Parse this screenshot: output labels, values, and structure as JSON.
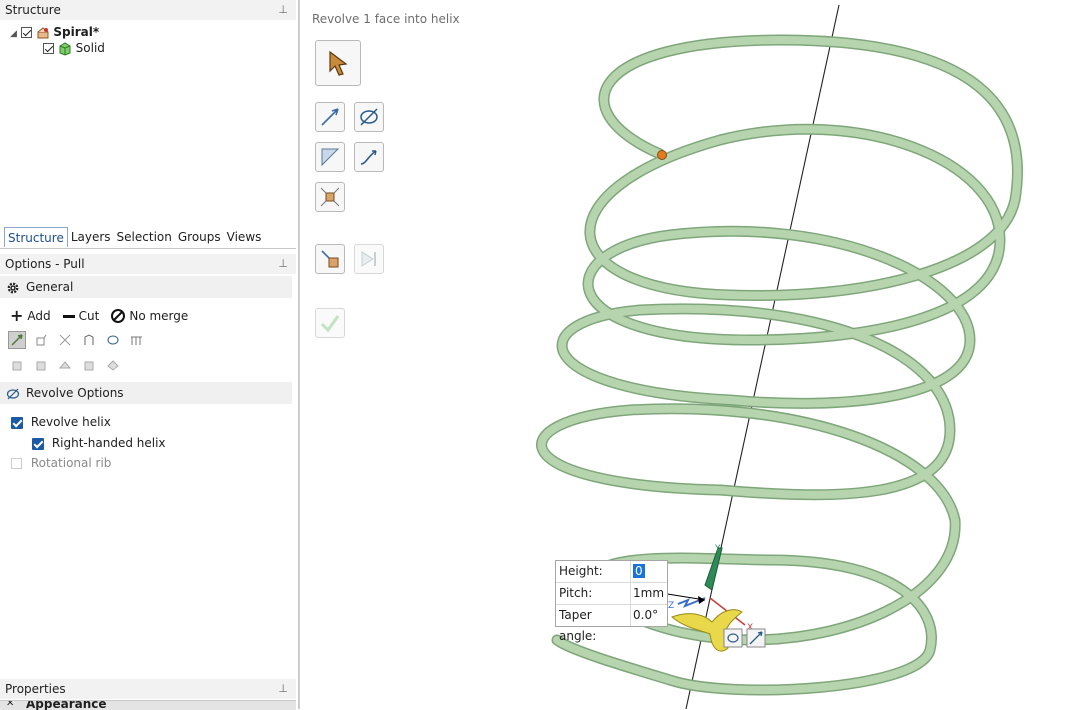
{
  "structure": {
    "title": "Structure",
    "items": [
      {
        "label": "Spiral*",
        "checked": true,
        "icon": "part-icon"
      },
      {
        "label": "Solid",
        "checked": true,
        "icon": "solid-cube-icon"
      }
    ]
  },
  "tabs": [
    "Structure",
    "Layers",
    "Selection",
    "Groups",
    "Views"
  ],
  "active_tab": "Structure",
  "options": {
    "title": "Options - Pull",
    "general_label": "General",
    "add_label": "Add",
    "cut_label": "Cut",
    "nomerge_label": "No merge",
    "revolve_section": "Revolve Options",
    "revolve_helix": {
      "label": "Revolve helix",
      "checked": true
    },
    "right_handed": {
      "label": "Right-handed helix",
      "checked": true
    },
    "rotational_rib": {
      "label": "Rotational rib",
      "checked": false,
      "enabled": false
    }
  },
  "properties": {
    "title": "Properties",
    "next_section": "Appearance"
  },
  "viewport": {
    "status": "Revolve 1 face into helix",
    "helix_color": "#b6d4ae",
    "helix_edge": "#7fa67a",
    "axis_color": "#222222"
  },
  "dimensions": [
    {
      "label": "Height:",
      "value": "0",
      "highlight": true
    },
    {
      "label": "Pitch:",
      "value": "1mm",
      "highlight": false
    },
    {
      "label": "Taper angle:",
      "value": "0.0°",
      "highlight": false
    }
  ],
  "triad": {
    "y_label": "Y",
    "z_label": "Z",
    "x_label": "X"
  }
}
